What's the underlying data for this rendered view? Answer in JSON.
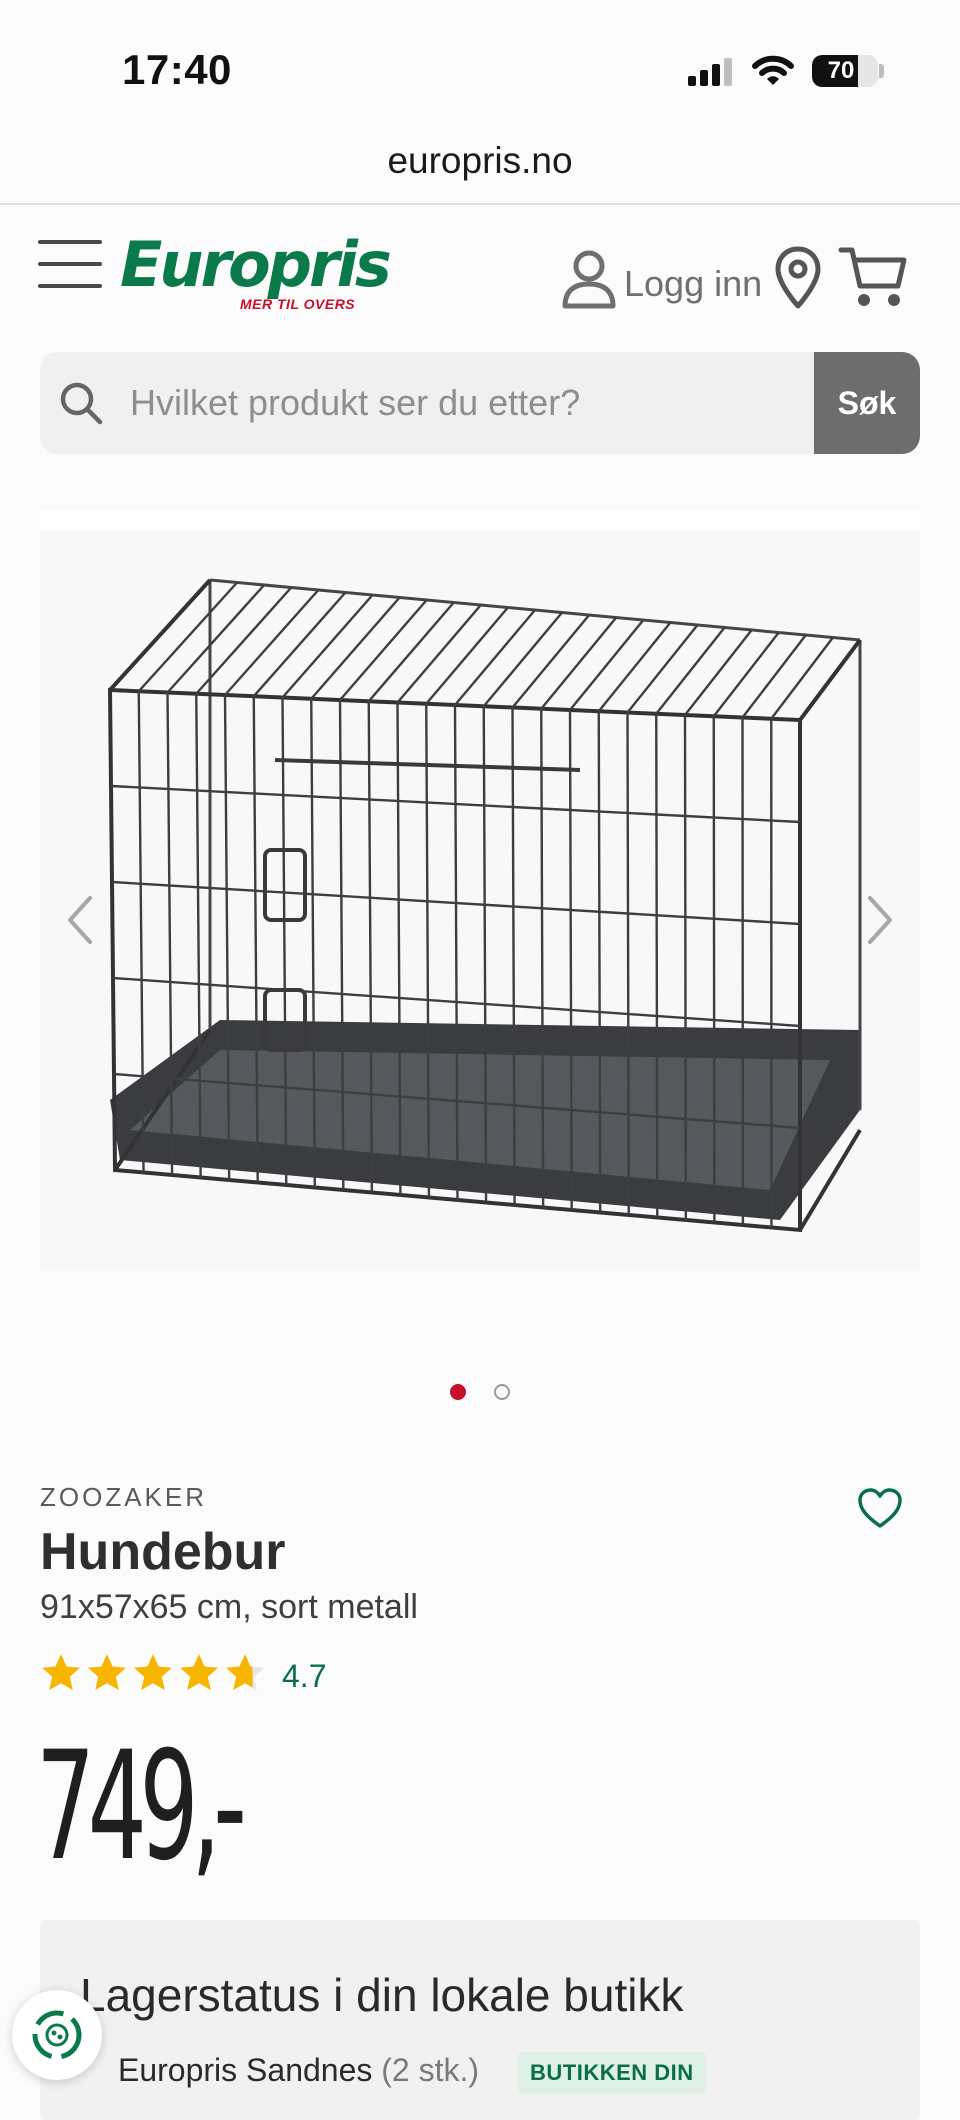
{
  "status_bar": {
    "time": "17:40",
    "battery": "70",
    "battery_level": 0.7,
    "icons": [
      "cellular-signal-icon",
      "wifi-icon",
      "battery-icon"
    ]
  },
  "browser": {
    "url": "europris.no"
  },
  "header": {
    "logo_text": "Europris",
    "logo_tagline": "MER TIL OVERS",
    "login_label": "Logg inn",
    "icons": [
      "menu-icon",
      "user-icon",
      "location-pin-icon",
      "cart-icon"
    ]
  },
  "search": {
    "placeholder": "Hvilket produkt ser du etter?",
    "button_label": "Søk"
  },
  "gallery": {
    "image_alt": "Hundebur",
    "image_count": 2,
    "active_index": 1
  },
  "product": {
    "brand": "ZOOZAKER",
    "title": "Hundebur",
    "subtitle": "91x57x65 cm, sort metall",
    "rating": 4.7,
    "rating_text": "4.7",
    "price": "749,-"
  },
  "stock": {
    "title": "Lagerstatus i din lokale butikk",
    "store_name": "Europris Sandnes",
    "store_qty": "(2 stk.)",
    "store_badge": "BUTIKKEN DIN"
  },
  "colors": {
    "brand_green": "#0b7a4a",
    "brand_red": "#c8102e",
    "star_yellow": "#f7b500",
    "search_button": "#6d6d6d"
  }
}
